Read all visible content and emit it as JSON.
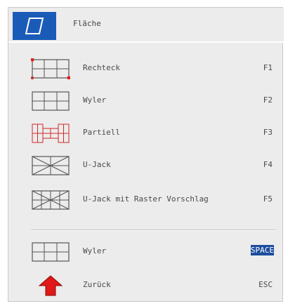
{
  "header": {
    "title": "Fläche",
    "icon": "parallelogram-icon",
    "accent": "#1a5bb8"
  },
  "menu_items": [
    {
      "label": "Rechteck",
      "key": "F1",
      "icon": "rectangle-grid-corner-points-icon"
    },
    {
      "label": "Wyler",
      "key": "F2",
      "icon": "grid-icon"
    },
    {
      "label": "Partiell",
      "key": "F3",
      "icon": "partial-grid-red-icon"
    },
    {
      "label": "U-Jack",
      "key": "F4",
      "icon": "u-jack-icon"
    },
    {
      "label": "U-Jack mit Raster Vorschlag",
      "key": "F5",
      "icon": "u-jack-grid-icon"
    }
  ],
  "bottom_items": [
    {
      "label": "Wyler",
      "key": "SPACE",
      "icon": "grid-icon",
      "key_highlight": "#1c4d9e"
    },
    {
      "label": "Zurück",
      "key": "ESC",
      "icon": "arrow-up-red-icon"
    }
  ]
}
